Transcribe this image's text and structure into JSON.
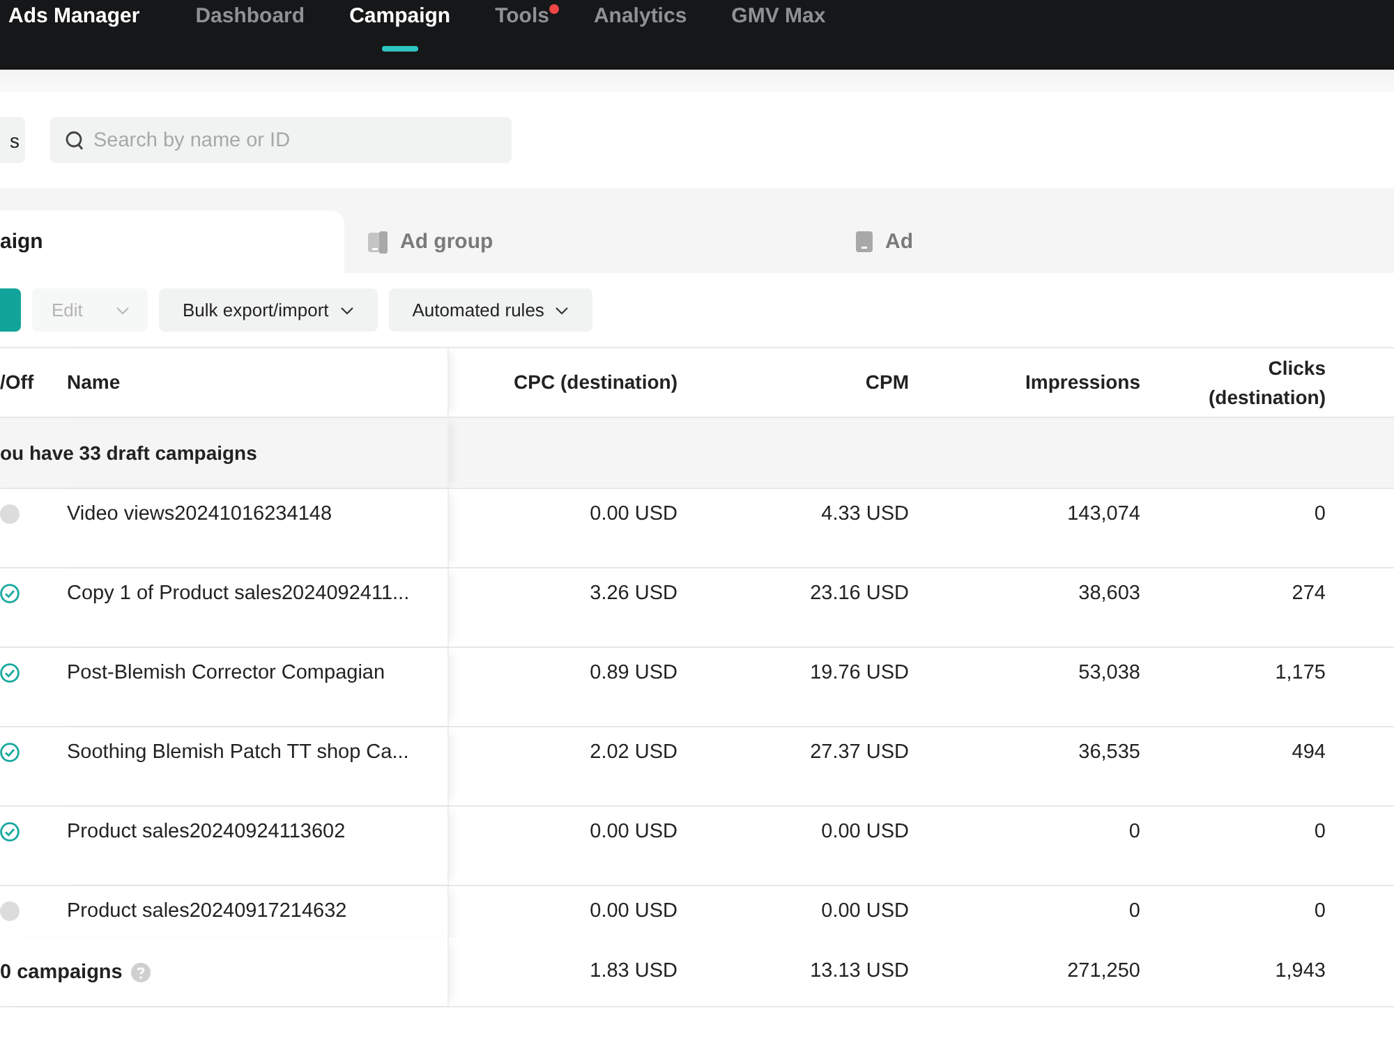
{
  "top_nav": {
    "app_title": "Ads Manager",
    "items": [
      {
        "label": "Dashboard",
        "selected": false,
        "badge": false
      },
      {
        "label": "Campaign",
        "selected": true,
        "badge": false
      },
      {
        "label": "Tools",
        "selected": false,
        "badge": true
      },
      {
        "label": "Analytics",
        "selected": false,
        "badge": false
      },
      {
        "label": "GMV Max",
        "selected": false,
        "badge": false
      }
    ]
  },
  "filter_bar": {
    "button_label": "s",
    "search": {
      "placeholder": "Search by name or ID"
    }
  },
  "level_tabs": [
    {
      "kind": "campaign",
      "label": "aign",
      "selected": true
    },
    {
      "kind": "ad_group",
      "label": "Ad group",
      "selected": false
    },
    {
      "kind": "ad",
      "label": "Ad",
      "selected": false
    }
  ],
  "toolbar": [
    {
      "kind": "primary"
    },
    {
      "kind": "dropdown",
      "label": "Edit",
      "disabled": true
    },
    {
      "kind": "dropdown",
      "label": "Bulk export/import",
      "disabled": false
    },
    {
      "kind": "dropdown",
      "label": "Automated rules",
      "disabled": false
    }
  ],
  "table": {
    "columns": [
      "/Off",
      "Name",
      "CPC (destination)",
      "CPM",
      "Impressions",
      "Clicks (destination)"
    ],
    "draft_row": "ou have 33 draft campaigns",
    "rows": [
      {
        "on": false,
        "name": "Video views20241016234148",
        "cpc": "0.00 USD",
        "cpm": "4.33 USD",
        "impressions": "143,074",
        "clicks": "0"
      },
      {
        "on": true,
        "name": "Copy 1 of Product sales2024092411...",
        "cpc": "3.26 USD",
        "cpm": "23.16 USD",
        "impressions": "38,603",
        "clicks": "274"
      },
      {
        "on": true,
        "name": "Post-Blemish Corrector Compagian",
        "cpc": "0.89 USD",
        "cpm": "19.76 USD",
        "impressions": "53,038",
        "clicks": "1,175"
      },
      {
        "on": true,
        "name": "Soothing Blemish Patch TT shop Ca...",
        "cpc": "2.02 USD",
        "cpm": "27.37 USD",
        "impressions": "36,535",
        "clicks": "494"
      },
      {
        "on": true,
        "name": "Product sales20240924113602",
        "cpc": "0.00 USD",
        "cpm": "0.00 USD",
        "impressions": "0",
        "clicks": "0"
      },
      {
        "on": false,
        "name": "Product sales20240917214632",
        "cpc": "0.00 USD",
        "cpm": "0.00 USD",
        "impressions": "0",
        "clicks": "0"
      }
    ],
    "total_row": {
      "label": "0 campaigns",
      "cpc": "1.83 USD",
      "cpm": "13.13 USD",
      "impressions": "271,250",
      "clicks": "1,943"
    }
  }
}
